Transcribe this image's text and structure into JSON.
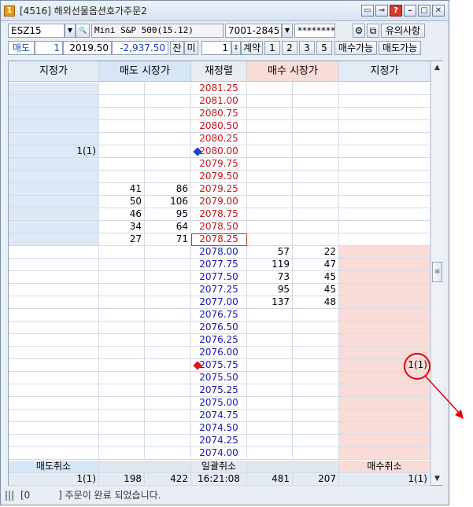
{
  "window": {
    "title": "[4516] 해외선물옵션호가주문2",
    "app_icon": "1",
    "buttons": [
      "screen-icon",
      "pin-icon",
      "help-icon",
      "minimize-icon",
      "maximize-icon",
      "close-icon"
    ],
    "help_label": "?"
  },
  "toolbar": {
    "symbol_code": "ESZ15",
    "symbol_name": "Mini S&P 500(15.12)",
    "account": "7001-2845",
    "password": "********",
    "notice_button": "유의사항",
    "side_label": "매도",
    "quantity": "1",
    "price": "2019.50",
    "change": "-2,937.50",
    "mode_btn1": "잔",
    "mode_btn2": "미",
    "order_qty": "1",
    "order_unit": "계약",
    "qty_presets": [
      "1",
      "2",
      "3",
      "5"
    ],
    "buy_available": "매수가능",
    "sell_available": "매도가능"
  },
  "grid": {
    "headers": [
      "지정가",
      "매도 시장가",
      "재정렬",
      "매수 시장가",
      "지정가"
    ],
    "rows": [
      {
        "sell_limit": "",
        "sell_cnt": "",
        "sell_qty": "",
        "price": "2081.25",
        "buy_qty": "",
        "buy_cnt": "",
        "buy_limit": "",
        "side": "ask"
      },
      {
        "sell_limit": "",
        "sell_cnt": "",
        "sell_qty": "",
        "price": "2081.00",
        "buy_qty": "",
        "buy_cnt": "",
        "buy_limit": "",
        "side": "ask"
      },
      {
        "sell_limit": "",
        "sell_cnt": "",
        "sell_qty": "",
        "price": "2080.75",
        "buy_qty": "",
        "buy_cnt": "",
        "buy_limit": "",
        "side": "ask"
      },
      {
        "sell_limit": "",
        "sell_cnt": "",
        "sell_qty": "",
        "price": "2080.50",
        "buy_qty": "",
        "buy_cnt": "",
        "buy_limit": "",
        "side": "ask"
      },
      {
        "sell_limit": "",
        "sell_cnt": "",
        "sell_qty": "",
        "price": "2080.25",
        "buy_qty": "",
        "buy_cnt": "",
        "buy_limit": "",
        "side": "ask"
      },
      {
        "sell_limit": "1(1)",
        "sell_cnt": "",
        "sell_qty": "",
        "price": "2080.00",
        "buy_qty": "",
        "buy_cnt": "",
        "buy_limit": "",
        "side": "ask",
        "marker": "blue"
      },
      {
        "sell_limit": "",
        "sell_cnt": "",
        "sell_qty": "",
        "price": "2079.75",
        "buy_qty": "",
        "buy_cnt": "",
        "buy_limit": "",
        "side": "ask"
      },
      {
        "sell_limit": "",
        "sell_cnt": "",
        "sell_qty": "",
        "price": "2079.50",
        "buy_qty": "",
        "buy_cnt": "",
        "buy_limit": "",
        "side": "ask"
      },
      {
        "sell_limit": "",
        "sell_cnt": "41",
        "sell_qty": "86",
        "price": "2079.25",
        "buy_qty": "",
        "buy_cnt": "",
        "buy_limit": "",
        "side": "ask"
      },
      {
        "sell_limit": "",
        "sell_cnt": "50",
        "sell_qty": "106",
        "price": "2079.00",
        "buy_qty": "",
        "buy_cnt": "",
        "buy_limit": "",
        "side": "ask"
      },
      {
        "sell_limit": "",
        "sell_cnt": "46",
        "sell_qty": "95",
        "price": "2078.75",
        "buy_qty": "",
        "buy_cnt": "",
        "buy_limit": "",
        "side": "ask"
      },
      {
        "sell_limit": "",
        "sell_cnt": "34",
        "sell_qty": "64",
        "price": "2078.50",
        "buy_qty": "",
        "buy_cnt": "",
        "buy_limit": "",
        "side": "ask"
      },
      {
        "sell_limit": "",
        "sell_cnt": "27",
        "sell_qty": "71",
        "price": "2078.25",
        "buy_qty": "",
        "buy_cnt": "",
        "buy_limit": "",
        "side": "ask",
        "current": true
      },
      {
        "sell_limit": "",
        "sell_cnt": "",
        "sell_qty": "",
        "price": "2078.00",
        "buy_qty": "57",
        "buy_cnt": "22",
        "buy_limit": "",
        "side": "bid"
      },
      {
        "sell_limit": "",
        "sell_cnt": "",
        "sell_qty": "",
        "price": "2077.75",
        "buy_qty": "119",
        "buy_cnt": "47",
        "buy_limit": "",
        "side": "bid"
      },
      {
        "sell_limit": "",
        "sell_cnt": "",
        "sell_qty": "",
        "price": "2077.50",
        "buy_qty": "73",
        "buy_cnt": "45",
        "buy_limit": "",
        "side": "bid"
      },
      {
        "sell_limit": "",
        "sell_cnt": "",
        "sell_qty": "",
        "price": "2077.25",
        "buy_qty": "95",
        "buy_cnt": "45",
        "buy_limit": "",
        "side": "bid"
      },
      {
        "sell_limit": "",
        "sell_cnt": "",
        "sell_qty": "",
        "price": "2077.00",
        "buy_qty": "137",
        "buy_cnt": "48",
        "buy_limit": "",
        "side": "bid"
      },
      {
        "sell_limit": "",
        "sell_cnt": "",
        "sell_qty": "",
        "price": "2076.75",
        "buy_qty": "",
        "buy_cnt": "",
        "buy_limit": "",
        "side": "bid"
      },
      {
        "sell_limit": "",
        "sell_cnt": "",
        "sell_qty": "",
        "price": "2076.50",
        "buy_qty": "",
        "buy_cnt": "",
        "buy_limit": "",
        "side": "bid"
      },
      {
        "sell_limit": "",
        "sell_cnt": "",
        "sell_qty": "",
        "price": "2076.25",
        "buy_qty": "",
        "buy_cnt": "",
        "buy_limit": "",
        "side": "bid"
      },
      {
        "sell_limit": "",
        "sell_cnt": "",
        "sell_qty": "",
        "price": "2076.00",
        "buy_qty": "",
        "buy_cnt": "",
        "buy_limit": "",
        "side": "bid"
      },
      {
        "sell_limit": "",
        "sell_cnt": "",
        "sell_qty": "",
        "price": "2075.75",
        "buy_qty": "",
        "buy_cnt": "",
        "buy_limit": "1(1)",
        "side": "bid",
        "marker": "red"
      },
      {
        "sell_limit": "",
        "sell_cnt": "",
        "sell_qty": "",
        "price": "2075.50",
        "buy_qty": "",
        "buy_cnt": "",
        "buy_limit": "",
        "side": "bid"
      },
      {
        "sell_limit": "",
        "sell_cnt": "",
        "sell_qty": "",
        "price": "2075.25",
        "buy_qty": "",
        "buy_cnt": "",
        "buy_limit": "",
        "side": "bid"
      },
      {
        "sell_limit": "",
        "sell_cnt": "",
        "sell_qty": "",
        "price": "2075.00",
        "buy_qty": "",
        "buy_cnt": "",
        "buy_limit": "",
        "side": "bid"
      },
      {
        "sell_limit": "",
        "sell_cnt": "",
        "sell_qty": "",
        "price": "2074.75",
        "buy_qty": "",
        "buy_cnt": "",
        "buy_limit": "",
        "side": "bid"
      },
      {
        "sell_limit": "",
        "sell_cnt": "",
        "sell_qty": "",
        "price": "2074.50",
        "buy_qty": "",
        "buy_cnt": "",
        "buy_limit": "",
        "side": "bid"
      },
      {
        "sell_limit": "",
        "sell_cnt": "",
        "sell_qty": "",
        "price": "2074.25",
        "buy_qty": "",
        "buy_cnt": "",
        "buy_limit": "",
        "side": "bid"
      },
      {
        "sell_limit": "",
        "sell_cnt": "",
        "sell_qty": "",
        "price": "2074.00",
        "buy_qty": "",
        "buy_cnt": "",
        "buy_limit": "",
        "side": "bid"
      }
    ],
    "footer": {
      "cancel_sell": "매도취소",
      "cancel_all": "일괄취소",
      "cancel_buy": "매수취소",
      "sell_limit_total": "1(1)",
      "sell_cnt_total": "198",
      "sell_qty_total": "422",
      "time": "16:21:08",
      "buy_qty_total": "481",
      "buy_cnt_total": "207",
      "buy_limit_total": "1(1)"
    }
  },
  "status": {
    "prefix": "|||",
    "code": "[0",
    "message": "] 주문이 완료 되었습니다."
  },
  "colors": {
    "ask_price": "#c0171a",
    "bid_price": "#1a1ab0",
    "sell_header_bg": "#d6e6f7",
    "buy_header_bg": "#f9dcd8",
    "sell_limit_bg": "#dde9f6",
    "buy_limit_bg": "#f9dcd8",
    "annotation": "#e00000"
  }
}
